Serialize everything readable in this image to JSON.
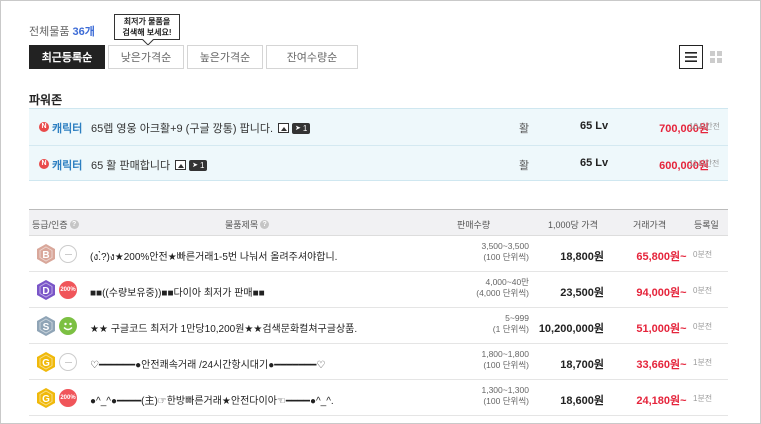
{
  "summary": {
    "label": "전체물품",
    "count": "36개"
  },
  "tooltip": {
    "line1": "최저가 물품을",
    "line2": "검색해 보세요!"
  },
  "sort_tabs": [
    {
      "label": "최근등록순",
      "active": true
    },
    {
      "label": "낮은가격순",
      "active": false
    },
    {
      "label": "높은가격순",
      "active": false
    },
    {
      "label": "잔여수량순",
      "active": false
    }
  ],
  "view_toggle": {
    "list_icon": "list-icon",
    "grid_icon": "grid-icon",
    "selected": "list"
  },
  "power_zone": {
    "title": "파워존",
    "rows": [
      {
        "badge": "N",
        "category": "캐릭터",
        "title": "65렙 영웅 아크활+9 (구글 깡통) 팝니다.",
        "image_count": "1",
        "type": "활",
        "level": "65 Lv",
        "price": "700,000원",
        "time": "10시간전"
      },
      {
        "badge": "N",
        "category": "캐릭터",
        "title": "65 활 판매합니다",
        "image_count": "1",
        "type": "활",
        "level": "65 Lv",
        "price": "600,000원",
        "time": "11시간전"
      }
    ]
  },
  "table": {
    "headers": {
      "grade": "등급/인증",
      "title": "물품제목",
      "qty": "판매수량",
      "unit_price": "1,000당 가격",
      "price": "거래가격",
      "date": "등록일"
    },
    "rows": [
      {
        "grade": "B",
        "grade_color": "#d9a79a",
        "cert": "none",
        "cert_text": "",
        "title": "(ง.̀̀?)ง★200%안전★빠른거래1-5번 나눠서 올려주셔야합니.",
        "qty1": "3,500~3,500",
        "qty2": "(100 단위씩)",
        "unit": "18,800원",
        "price": "65,800원~",
        "time": "0분전"
      },
      {
        "grade": "D",
        "grade_color": "#7a55c8",
        "cert": "pct",
        "cert_text": "200%",
        "title": "■■((수량보유중))■■다이아 최저가 판매■■",
        "qty1": "4,000~40만",
        "qty2": "(4,000 단위씩)",
        "unit": "23,500원",
        "price": "94,000원~",
        "time": "0분전"
      },
      {
        "grade": "S",
        "grade_color": "#8fa4b6",
        "cert": "smile",
        "cert_text": "",
        "title": "★★ 구글코드 최저가 1만당10,200원★★검색문화컬쳐구글상품.",
        "qty1": "5~999",
        "qty2": "(1 단위씩)",
        "unit": "10,200,000원",
        "price": "51,000원~",
        "time": "0분전"
      },
      {
        "grade": "G",
        "grade_color": "#f0b90b",
        "cert": "none",
        "cert_text": "",
        "title": "♡━━━━━━●안전쾌속거래 /24시간항시대기●━━━━━━━♡",
        "qty1": "1,800~1,800",
        "qty2": "(100 단위씩)",
        "unit": "18,700원",
        "price": "33,660원~",
        "time": "1분전"
      },
      {
        "grade": "G",
        "grade_color": "#f0b90b",
        "cert": "pct",
        "cert_text": "200%",
        "title": "●^_^●━━━━(主)☞한방빠른거래★안전다이아☜━━━━●^_^.",
        "qty1": "1,300~1,300",
        "qty2": "(100 단위씩)",
        "unit": "18,600원",
        "price": "24,180원~",
        "time": "1분전"
      }
    ]
  }
}
